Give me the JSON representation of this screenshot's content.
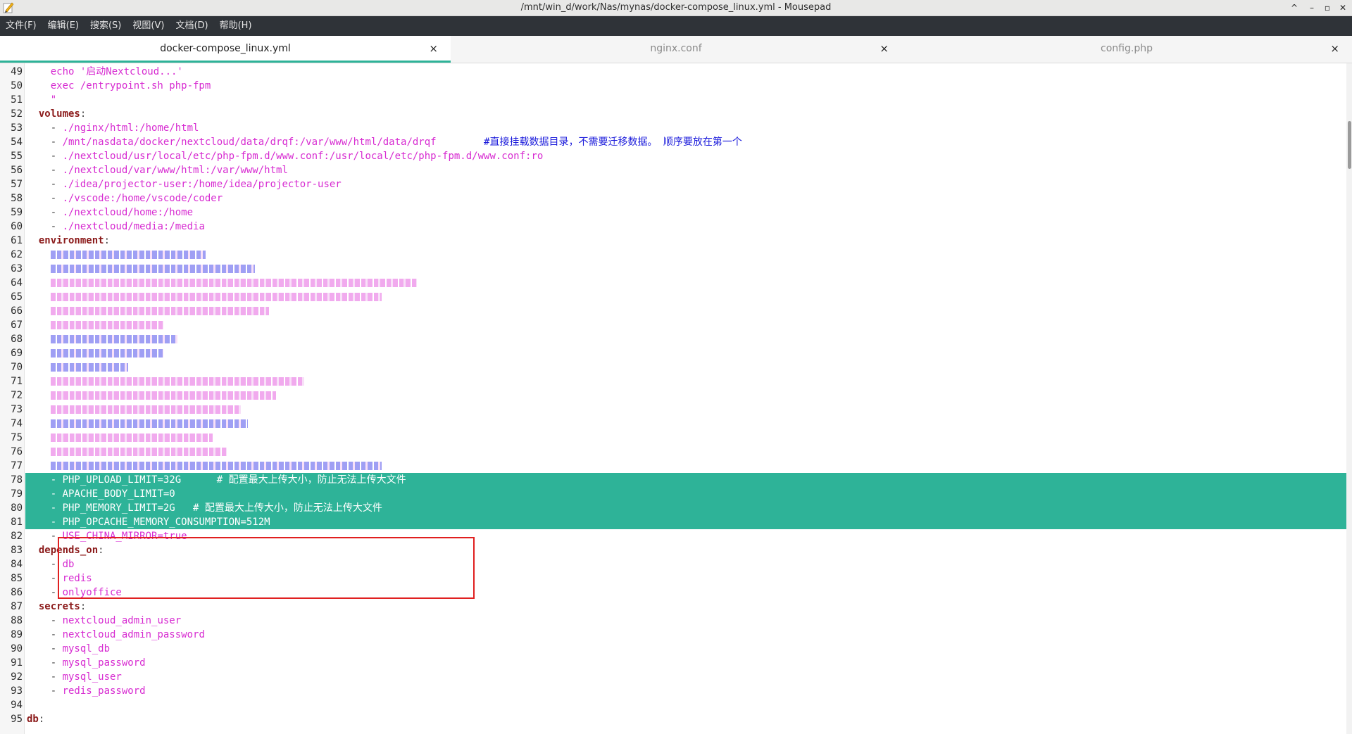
{
  "window": {
    "title": "/mnt/win_d/work/Nas/mynas/docker-compose_linux.yml - Mousepad",
    "minimize": "^",
    "maximize": "–",
    "restore": "▫",
    "close": "✕"
  },
  "menu": [
    "文件(F)",
    "编辑(E)",
    "搜索(S)",
    "视图(V)",
    "文档(D)",
    "帮助(H)"
  ],
  "tabs": [
    {
      "label": "docker-compose_linux.yml",
      "active": true,
      "close": "×"
    },
    {
      "label": "nginx.conf",
      "active": false,
      "close": "×"
    },
    {
      "label": "config.php",
      "active": false,
      "close": "×"
    }
  ],
  "lines": [
    {
      "n": "49",
      "parts": [
        [
          "p",
          "    "
        ],
        [
          "s",
          "echo '启动Nextcloud...'"
        ]
      ]
    },
    {
      "n": "50",
      "parts": [
        [
          "p",
          "    "
        ],
        [
          "s",
          "exec /entrypoint.sh php-fpm"
        ]
      ]
    },
    {
      "n": "51",
      "parts": [
        [
          "p",
          "    "
        ],
        [
          "s",
          "\""
        ]
      ]
    },
    {
      "n": "52",
      "parts": [
        [
          "p",
          "  "
        ],
        [
          "k",
          "volumes"
        ],
        [
          "p",
          ":"
        ]
      ]
    },
    {
      "n": "53",
      "parts": [
        [
          "p",
          "    - "
        ],
        [
          "s",
          "./nginx/html:/home/html"
        ]
      ]
    },
    {
      "n": "54",
      "parts": [
        [
          "p",
          "    - "
        ],
        [
          "s",
          "/mnt/nasdata/docker/nextcloud/data/drqf:/var/www/html/data/drqf"
        ],
        [
          "p",
          "        "
        ],
        [
          "c",
          "#直接挂载数据目录，不需要迁移数据。 顺序要放在第一个"
        ]
      ]
    },
    {
      "n": "55",
      "parts": [
        [
          "p",
          "    - "
        ],
        [
          "s",
          "./nextcloud/usr/local/etc/php-fpm.d/www.conf:/usr/local/etc/php-fpm.d/www.conf:ro"
        ]
      ]
    },
    {
      "n": "56",
      "parts": [
        [
          "p",
          "    - "
        ],
        [
          "s",
          "./nextcloud/var/www/html:/var/www/html"
        ]
      ]
    },
    {
      "n": "57",
      "parts": [
        [
          "p",
          "    - "
        ],
        [
          "s",
          "./idea/projector-user:/home/idea/projector-user"
        ]
      ]
    },
    {
      "n": "58",
      "parts": [
        [
          "p",
          "    - "
        ],
        [
          "s",
          "./vscode:/home/vscode/coder"
        ]
      ]
    },
    {
      "n": "59",
      "parts": [
        [
          "p",
          "    - "
        ],
        [
          "s",
          "./nextcloud/home:/home"
        ]
      ]
    },
    {
      "n": "60",
      "parts": [
        [
          "p",
          "    - "
        ],
        [
          "s",
          "./nextcloud/media:/media"
        ]
      ]
    },
    {
      "n": "61",
      "parts": [
        [
          "p",
          "  "
        ],
        [
          "k",
          "environment"
        ],
        [
          "p",
          ":"
        ]
      ]
    },
    {
      "n": "62",
      "blur": "c"
    },
    {
      "n": "63",
      "blur": "c"
    },
    {
      "n": "64",
      "blur": "s"
    },
    {
      "n": "65",
      "blur": "s"
    },
    {
      "n": "66",
      "blur": "s"
    },
    {
      "n": "67",
      "blur": "s"
    },
    {
      "n": "68",
      "blur": "c"
    },
    {
      "n": "69",
      "blur": "c"
    },
    {
      "n": "70",
      "blur": "c"
    },
    {
      "n": "71",
      "blur": "s"
    },
    {
      "n": "72",
      "blur": "s"
    },
    {
      "n": "73",
      "blur": "s"
    },
    {
      "n": "74",
      "blur": "c"
    },
    {
      "n": "75",
      "blur": "s"
    },
    {
      "n": "76",
      "blur": "s"
    },
    {
      "n": "77",
      "blur": "c"
    },
    {
      "n": "78",
      "sel": true,
      "parts": [
        [
          "p",
          "    - "
        ],
        [
          "s",
          "PHP_UPLOAD_LIMIT=32G"
        ],
        [
          "p",
          "      "
        ],
        [
          "c",
          "# 配置最大上传大小，防止无法上传大文件"
        ]
      ]
    },
    {
      "n": "79",
      "sel": true,
      "parts": [
        [
          "p",
          "    - "
        ],
        [
          "s",
          "APACHE_BODY_LIMIT=0"
        ]
      ]
    },
    {
      "n": "80",
      "sel": true,
      "parts": [
        [
          "p",
          "    - "
        ],
        [
          "s",
          "PHP_MEMORY_LIMIT=2G"
        ],
        [
          "p",
          "   "
        ],
        [
          "c",
          "# 配置最大上传大小，防止无法上传大文件"
        ]
      ]
    },
    {
      "n": "81",
      "sel": true,
      "parts": [
        [
          "p",
          "    - "
        ],
        [
          "s",
          "PHP_OPCACHE_MEMORY_CONSUMPTION=512M"
        ]
      ]
    },
    {
      "n": "82",
      "parts": [
        [
          "p",
          "    - "
        ],
        [
          "s",
          "USE_CHINA_MIRROR=true"
        ]
      ]
    },
    {
      "n": "83",
      "parts": [
        [
          "p",
          "  "
        ],
        [
          "k",
          "depends_on"
        ],
        [
          "p",
          ":"
        ]
      ]
    },
    {
      "n": "84",
      "parts": [
        [
          "p",
          "    - "
        ],
        [
          "s",
          "db"
        ]
      ]
    },
    {
      "n": "85",
      "parts": [
        [
          "p",
          "    - "
        ],
        [
          "s",
          "redis"
        ]
      ]
    },
    {
      "n": "86",
      "parts": [
        [
          "p",
          "    - "
        ],
        [
          "s",
          "onlyoffice"
        ]
      ]
    },
    {
      "n": "87",
      "parts": [
        [
          "p",
          "  "
        ],
        [
          "k",
          "secrets"
        ],
        [
          "p",
          ":"
        ]
      ]
    },
    {
      "n": "88",
      "parts": [
        [
          "p",
          "    - "
        ],
        [
          "s",
          "nextcloud_admin_user"
        ]
      ]
    },
    {
      "n": "89",
      "parts": [
        [
          "p",
          "    - "
        ],
        [
          "s",
          "nextcloud_admin_password"
        ]
      ]
    },
    {
      "n": "90",
      "parts": [
        [
          "p",
          "    - "
        ],
        [
          "s",
          "mysql_db"
        ]
      ]
    },
    {
      "n": "91",
      "parts": [
        [
          "p",
          "    - "
        ],
        [
          "s",
          "mysql_password"
        ]
      ]
    },
    {
      "n": "92",
      "parts": [
        [
          "p",
          "    - "
        ],
        [
          "s",
          "mysql_user"
        ]
      ]
    },
    {
      "n": "93",
      "parts": [
        [
          "p",
          "    - "
        ],
        [
          "s",
          "redis_password"
        ]
      ]
    },
    {
      "n": "94",
      "parts": []
    },
    {
      "n": "95",
      "parts": [
        [
          "k",
          "db"
        ],
        [
          "p",
          ":"
        ]
      ]
    }
  ],
  "colors": {
    "selection": "#2eb398",
    "keyword": "#8b1a1a",
    "string": "#d72bd1",
    "comment": "#1a1adb",
    "highlight_box": "#e02020"
  }
}
